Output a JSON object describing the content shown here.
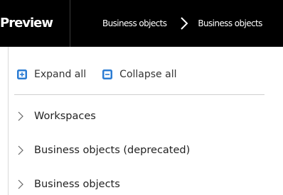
{
  "header": {
    "title": "Preview",
    "breadcrumb": {
      "parent": "Business objects",
      "current": "Business objects"
    }
  },
  "toolbar": {
    "expand_label": "Expand all",
    "collapse_label": "Collapse all"
  },
  "tree": {
    "items": [
      {
        "label": "Workspaces"
      },
      {
        "label": "Business objects (deprecated)"
      },
      {
        "label": "Business objects"
      }
    ]
  },
  "colors": {
    "header_bg": "#000000",
    "accent": "#2b7cd3"
  }
}
